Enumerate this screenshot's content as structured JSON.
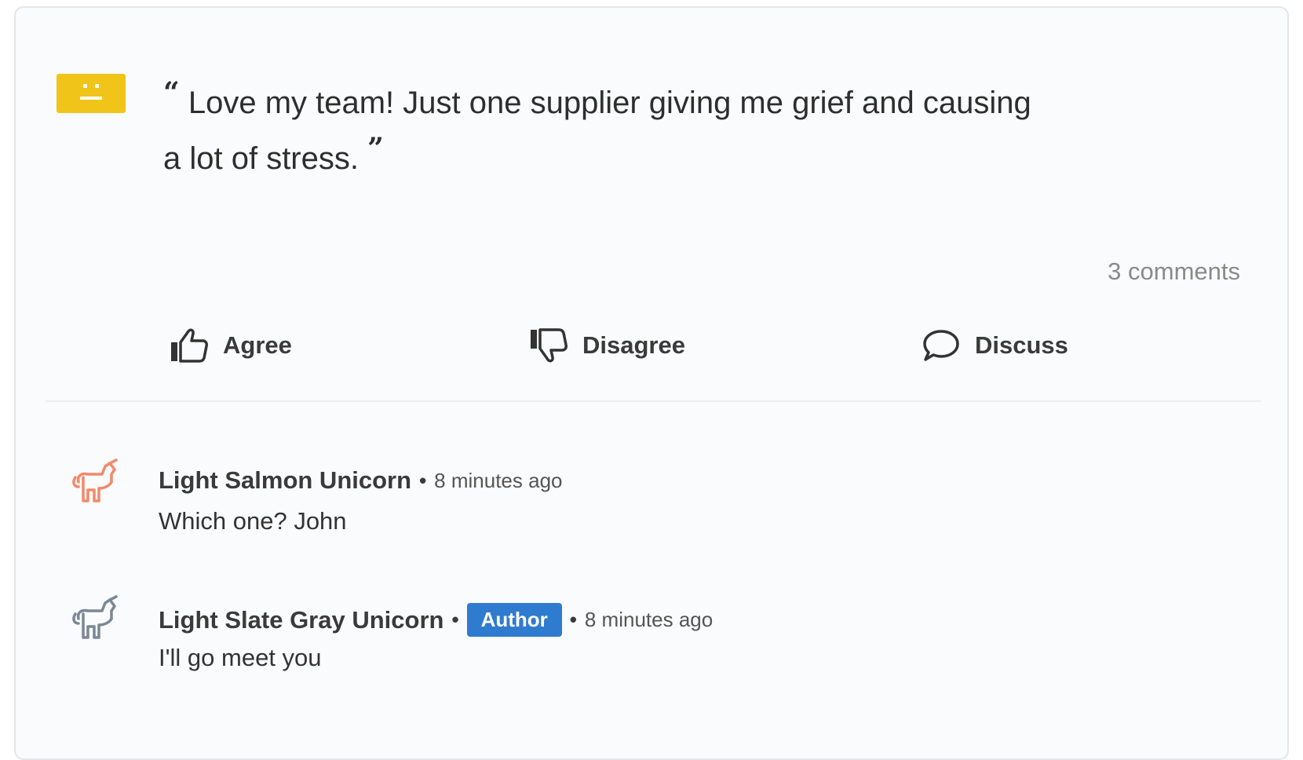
{
  "post": {
    "mood_icon": "neutral-face-icon",
    "mood_color": "#f0c419",
    "quote_open": "“",
    "quote_close": "”",
    "quote_line1": "Love my team! Just one supplier giving me grief and causing",
    "quote_line2": "a lot of stress.",
    "comments_count": "3 comments"
  },
  "actions": {
    "agree": {
      "label": "Agree",
      "icon": "thumbs-up-icon"
    },
    "disagree": {
      "label": "Disagree",
      "icon": "thumbs-down-icon"
    },
    "discuss": {
      "label": "Discuss",
      "icon": "speech-bubble-icon"
    }
  },
  "comments": [
    {
      "author": "Light Salmon Unicorn",
      "avatar_icon": "unicorn-icon",
      "avatar_color": "#f4886a",
      "separator": "•",
      "time": "8 minutes ago",
      "text": "Which one? John"
    },
    {
      "author": "Light Slate Gray Unicorn",
      "avatar_icon": "unicorn-icon",
      "avatar_color": "#7a8796",
      "separator": "•",
      "badge": "Author",
      "badge_color": "#2f7bcf",
      "time": "8 minutes ago",
      "text": "I'll go meet you"
    }
  ]
}
